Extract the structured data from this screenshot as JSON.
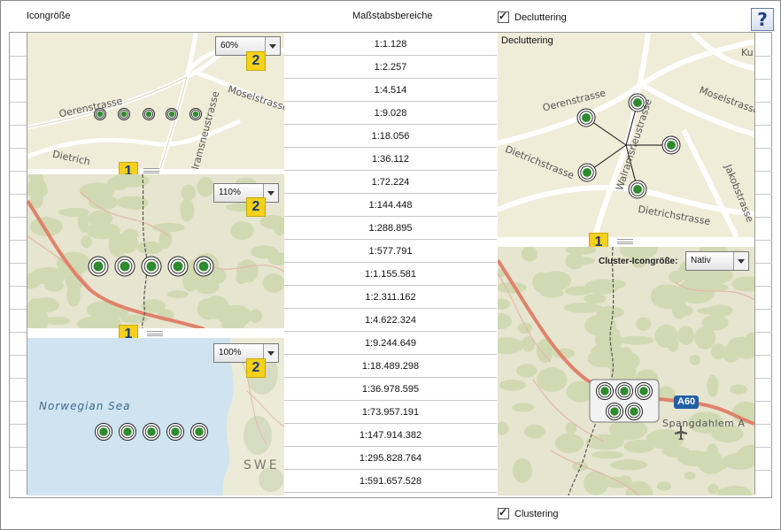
{
  "header": {
    "icon_size_label": "Icongröße",
    "scale_ranges_label": "Maßstabsbereiche",
    "decluttering_label": "Decluttering",
    "help_label": "?"
  },
  "footer": {
    "clustering_label": "Clustering"
  },
  "scales": [
    "1:1.128",
    "1:2.257",
    "1:4.514",
    "1:9.028",
    "1:18.056",
    "1:36.112",
    "1:72.224",
    "1:144.448",
    "1:288.895",
    "1:577.791",
    "1:1.155.581",
    "1:2.311.162",
    "1:4.622.324",
    "1:9.244.649",
    "1:18.489.298",
    "1:36.978.595",
    "1:73.957.191",
    "1:147.914.382",
    "1:295.828.764",
    "1:591.657.528"
  ],
  "panels": {
    "street": {
      "zoom": "60%",
      "badge_top": "2",
      "badge_bottom": "1",
      "labels": {
        "oeren": "Oerenstrasse",
        "mosel": "Moselstrasse",
        "dietrich": "Dietrich",
        "walram": "Walramsneustrasse"
      }
    },
    "terrain": {
      "zoom": "110%",
      "badge_top": "2",
      "badge_bottom": "1"
    },
    "sea": {
      "zoom": "100%",
      "badge_top": "2",
      "labels": {
        "sea": "Norwegian Sea",
        "swe": "SWE"
      }
    },
    "declutter": {
      "title": "Decluttering",
      "labels": {
        "oeren": "Oerenstrasse",
        "mosel": "Moselstrasse",
        "dietrich": "Dietrichstrasse",
        "dietrich2": "Dietrichstrasse",
        "walram": "Walramsneustrasse",
        "jakob": "Jakobstrasse",
        "ku": "Ku"
      }
    },
    "cluster": {
      "badge": "1",
      "size_label": "Cluster-Icongröße:",
      "size_value": "Nativ",
      "road_sign": "A60",
      "place": "Spangdahlem A"
    }
  },
  "colors": {
    "marker": "#2e8b2e",
    "badge": "#f5d11a",
    "road": "#e0826a",
    "water": "#cfe4f0",
    "land": "#efecd8"
  }
}
